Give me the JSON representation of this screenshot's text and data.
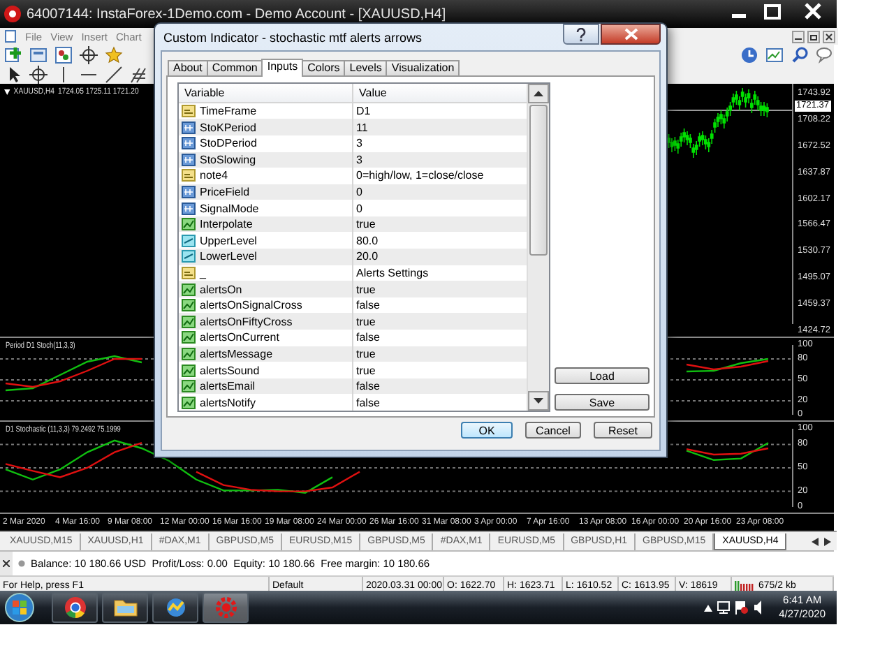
{
  "window": {
    "title": "64007144: InstaForex-1Demo.com - Demo Account - [XAUUSD,H4]"
  },
  "menu": [
    "File",
    "View",
    "Insert",
    "Chart"
  ],
  "chart": {
    "symbol": "XAUUSD,H4",
    "quotes": "1724.05 1725.11 1721.20",
    "current_price": "1721.37",
    "price_axis": [
      "1743.92",
      "1708.22",
      "1672.52",
      "1637.87",
      "1602.17",
      "1566.47",
      "1530.77",
      "1495.07",
      "1459.37",
      "1424.72"
    ],
    "indicators": [
      {
        "label": "Period D1 Stoch(11,3,3)",
        "chart_data": {
          "type": "line",
          "categories": [
            null,
            null,
            null,
            null,
            null,
            null,
            null,
            null,
            null,
            null,
            null,
            null,
            null,
            null,
            null,
            null,
            null,
            null,
            null,
            null,
            null,
            null,
            null,
            null,
            null,
            null,
            null,
            null,
            null
          ],
          "ylim": [
            0,
            100
          ],
          "yticks": [
            100,
            80,
            50,
            20,
            0
          ],
          "grid": true,
          "series": [
            {
              "color": "#10c010",
              "values": [
                35,
                38,
                57,
                76,
                84,
                75,
                null,
                null,
                null,
                null,
                null,
                null,
                null,
                null,
                null,
                null,
                null,
                null,
                null,
                null,
                null,
                null,
                null,
                null,
                null,
                62,
                63,
                74,
                80
              ]
            },
            {
              "color": "#e01010",
              "values": [
                45,
                40,
                48,
                63,
                80,
                80,
                null,
                null,
                null,
                null,
                null,
                null,
                null,
                null,
                null,
                null,
                null,
                null,
                null,
                null,
                null,
                null,
                null,
                null,
                null,
                72,
                65,
                69,
                77
              ]
            }
          ]
        }
      },
      {
        "label": "D1 Stochastic (11,3,3) 79.2492 75.1999",
        "chart_data": {
          "type": "line",
          "categories": [
            null,
            null,
            null,
            null,
            null,
            null,
            null,
            null,
            null,
            null,
            null,
            null,
            null,
            null,
            null,
            null,
            null,
            null,
            null,
            null,
            null,
            null,
            null,
            null,
            null,
            null,
            null,
            null,
            null
          ],
          "ylim": [
            0,
            100
          ],
          "yticks": [
            100,
            80,
            50,
            20,
            0
          ],
          "grid": true,
          "series": [
            {
              "color": "#10c010",
              "values": [
                48,
                35,
                48,
                70,
                85,
                75,
                59,
                35,
                21,
                21,
                22,
                18,
                38,
                null,
                null,
                null,
                null,
                null,
                null,
                null,
                null,
                null,
                null,
                null,
                null,
                72,
                60,
                62,
                82
              ]
            },
            {
              "color": "#e01010",
              "values": [
                55,
                46,
                38,
                50,
                70,
                82,
                null,
                45,
                28,
                22,
                20,
                20,
                25,
                45,
                null,
                null,
                null,
                null,
                null,
                null,
                null,
                null,
                null,
                null,
                null,
                74,
                67,
                68,
                75
              ]
            }
          ]
        }
      }
    ],
    "time_axis": [
      "2 Mar 2020",
      "4 Mar 16:00",
      "9 Mar 08:00",
      "12 Mar 00:00",
      "16 Mar 16:00",
      "19 Mar 08:00",
      "24 Mar 00:00",
      "26 Mar 16:00",
      "31 Mar 08:00",
      "3 Apr 00:00",
      "7 Apr 16:00",
      "13 Apr 08:00",
      "16 Apr 00:00",
      "20 Apr 16:00",
      "23 Apr 08:00"
    ]
  },
  "dialog": {
    "title": "Custom Indicator - stochastic mtf alerts arrows",
    "tabs": [
      {
        "label": "About",
        "selected": false
      },
      {
        "label": "Common",
        "selected": false
      },
      {
        "label": "Inputs",
        "selected": true
      },
      {
        "label": "Colors",
        "selected": false
      },
      {
        "label": "Levels",
        "selected": false
      },
      {
        "label": "Visualization",
        "selected": false
      }
    ],
    "columns": [
      "Variable",
      "Value"
    ],
    "rows": [
      {
        "kind": "string",
        "variable": "TimeFrame",
        "value": "D1"
      },
      {
        "kind": "int",
        "variable": "StoKPeriod",
        "value": "11"
      },
      {
        "kind": "int",
        "variable": "StoDPeriod",
        "value": "3"
      },
      {
        "kind": "int",
        "variable": "StoSlowing",
        "value": "3"
      },
      {
        "kind": "string",
        "variable": "note4",
        "value": "0=high/low, 1=close/close"
      },
      {
        "kind": "int",
        "variable": "PriceField",
        "value": "0"
      },
      {
        "kind": "int",
        "variable": "SignalMode",
        "value": "0"
      },
      {
        "kind": "bool",
        "variable": "Interpolate",
        "value": "true"
      },
      {
        "kind": "double",
        "variable": "UpperLevel",
        "value": "80.0"
      },
      {
        "kind": "double",
        "variable": "LowerLevel",
        "value": "20.0"
      },
      {
        "kind": "string",
        "variable": "_",
        "value": "Alerts Settings"
      },
      {
        "kind": "bool",
        "variable": "alertsOn",
        "value": "true"
      },
      {
        "kind": "bool",
        "variable": "alertsOnSignalCross",
        "value": "false"
      },
      {
        "kind": "bool",
        "variable": "alertsOnFiftyCross",
        "value": "true"
      },
      {
        "kind": "bool",
        "variable": "alertsOnCurrent",
        "value": "false"
      },
      {
        "kind": "bool",
        "variable": "alertsMessage",
        "value": "true"
      },
      {
        "kind": "bool",
        "variable": "alertsSound",
        "value": "true"
      },
      {
        "kind": "bool",
        "variable": "alertsEmail",
        "value": "false"
      },
      {
        "kind": "bool",
        "variable": "alertsNotify",
        "value": "false"
      }
    ],
    "side_buttons": [
      "Load",
      "Save"
    ],
    "buttons": [
      "OK",
      "Cancel",
      "Reset"
    ]
  },
  "chart_tabs": [
    {
      "label": "XAUUSD,M15",
      "selected": false
    },
    {
      "label": "XAUUSD,H1",
      "selected": false
    },
    {
      "label": "#DAX,M1",
      "selected": false
    },
    {
      "label": "GBPUSD,M5",
      "selected": false
    },
    {
      "label": "EURUSD,M15",
      "selected": false
    },
    {
      "label": "GBPUSD,M5",
      "selected": false
    },
    {
      "label": "#DAX,M1",
      "selected": false
    },
    {
      "label": "EURUSD,M5",
      "selected": false
    },
    {
      "label": "GBPUSD,H1",
      "selected": false
    },
    {
      "label": "GBPUSD,M15",
      "selected": false
    },
    {
      "label": "XAUUSD,H4",
      "selected": true
    }
  ],
  "account": "Balance: 10 180.66 USD  Profit/Loss: 0.00  Equity: 10 180.66  Free margin: 10 180.66",
  "status_bar": [
    "For Help, press F1",
    "Default",
    "2020.03.31 00:00",
    "O: 1622.70",
    "H: 1623.71",
    "L: 1610.52",
    "C: 1613.95",
    "V: 18619",
    "675/2 kb"
  ],
  "taskbar": {
    "time": "6:41 AM",
    "date": "4/27/2020"
  }
}
